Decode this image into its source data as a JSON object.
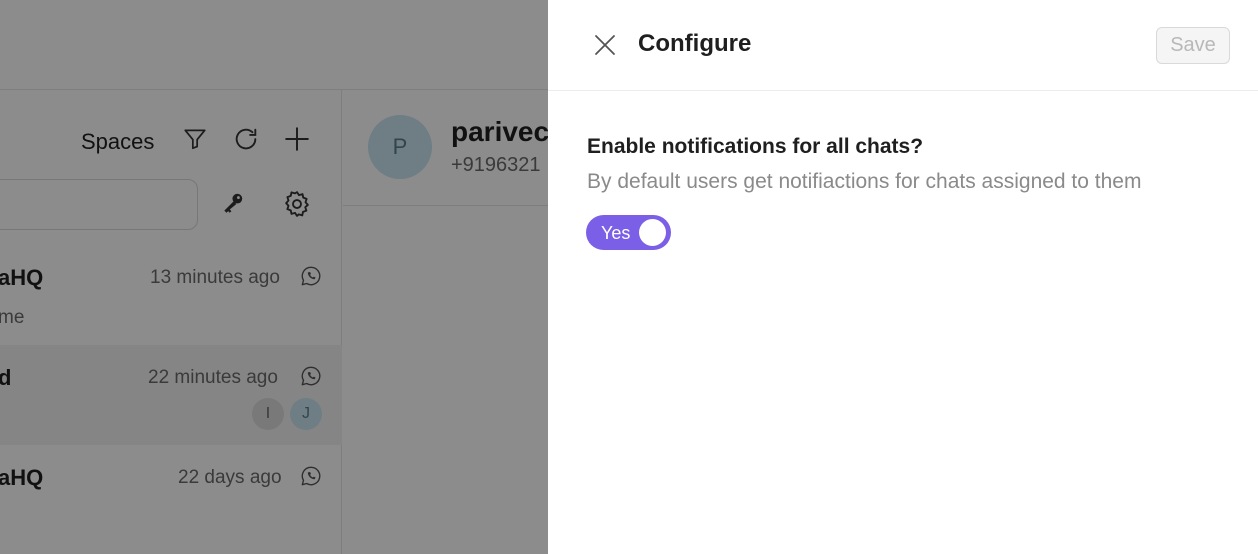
{
  "background": {
    "left_header": {
      "spaces_label": "Spaces",
      "icons": [
        "filter-icon",
        "refresh-icon",
        "plus-icon",
        "key-icon",
        "gear-icon"
      ]
    },
    "chats": [
      {
        "name": "aHQ",
        "time": "13 minutes ago",
        "snippet": "me",
        "avatars": []
      },
      {
        "name": "d",
        "time": "22 minutes ago",
        "snippet": "",
        "avatars": [
          "I",
          "J"
        ]
      },
      {
        "name": "aHQ",
        "time": "22 days ago",
        "snippet": "",
        "avatars": []
      }
    ],
    "conversation": {
      "avatar_letter": "P",
      "name": "parivec",
      "phone": "+9196321"
    }
  },
  "drawer": {
    "title": "Configure",
    "save_label": "Save",
    "setting": {
      "question": "Enable notifications for all chats?",
      "description": "By default users get notifiactions for chats assigned to them",
      "toggle_label": "Yes",
      "toggle_on": true
    }
  },
  "colors": {
    "accent": "#7b5fe6",
    "overlay": "rgba(0,0,0,0.45)"
  }
}
